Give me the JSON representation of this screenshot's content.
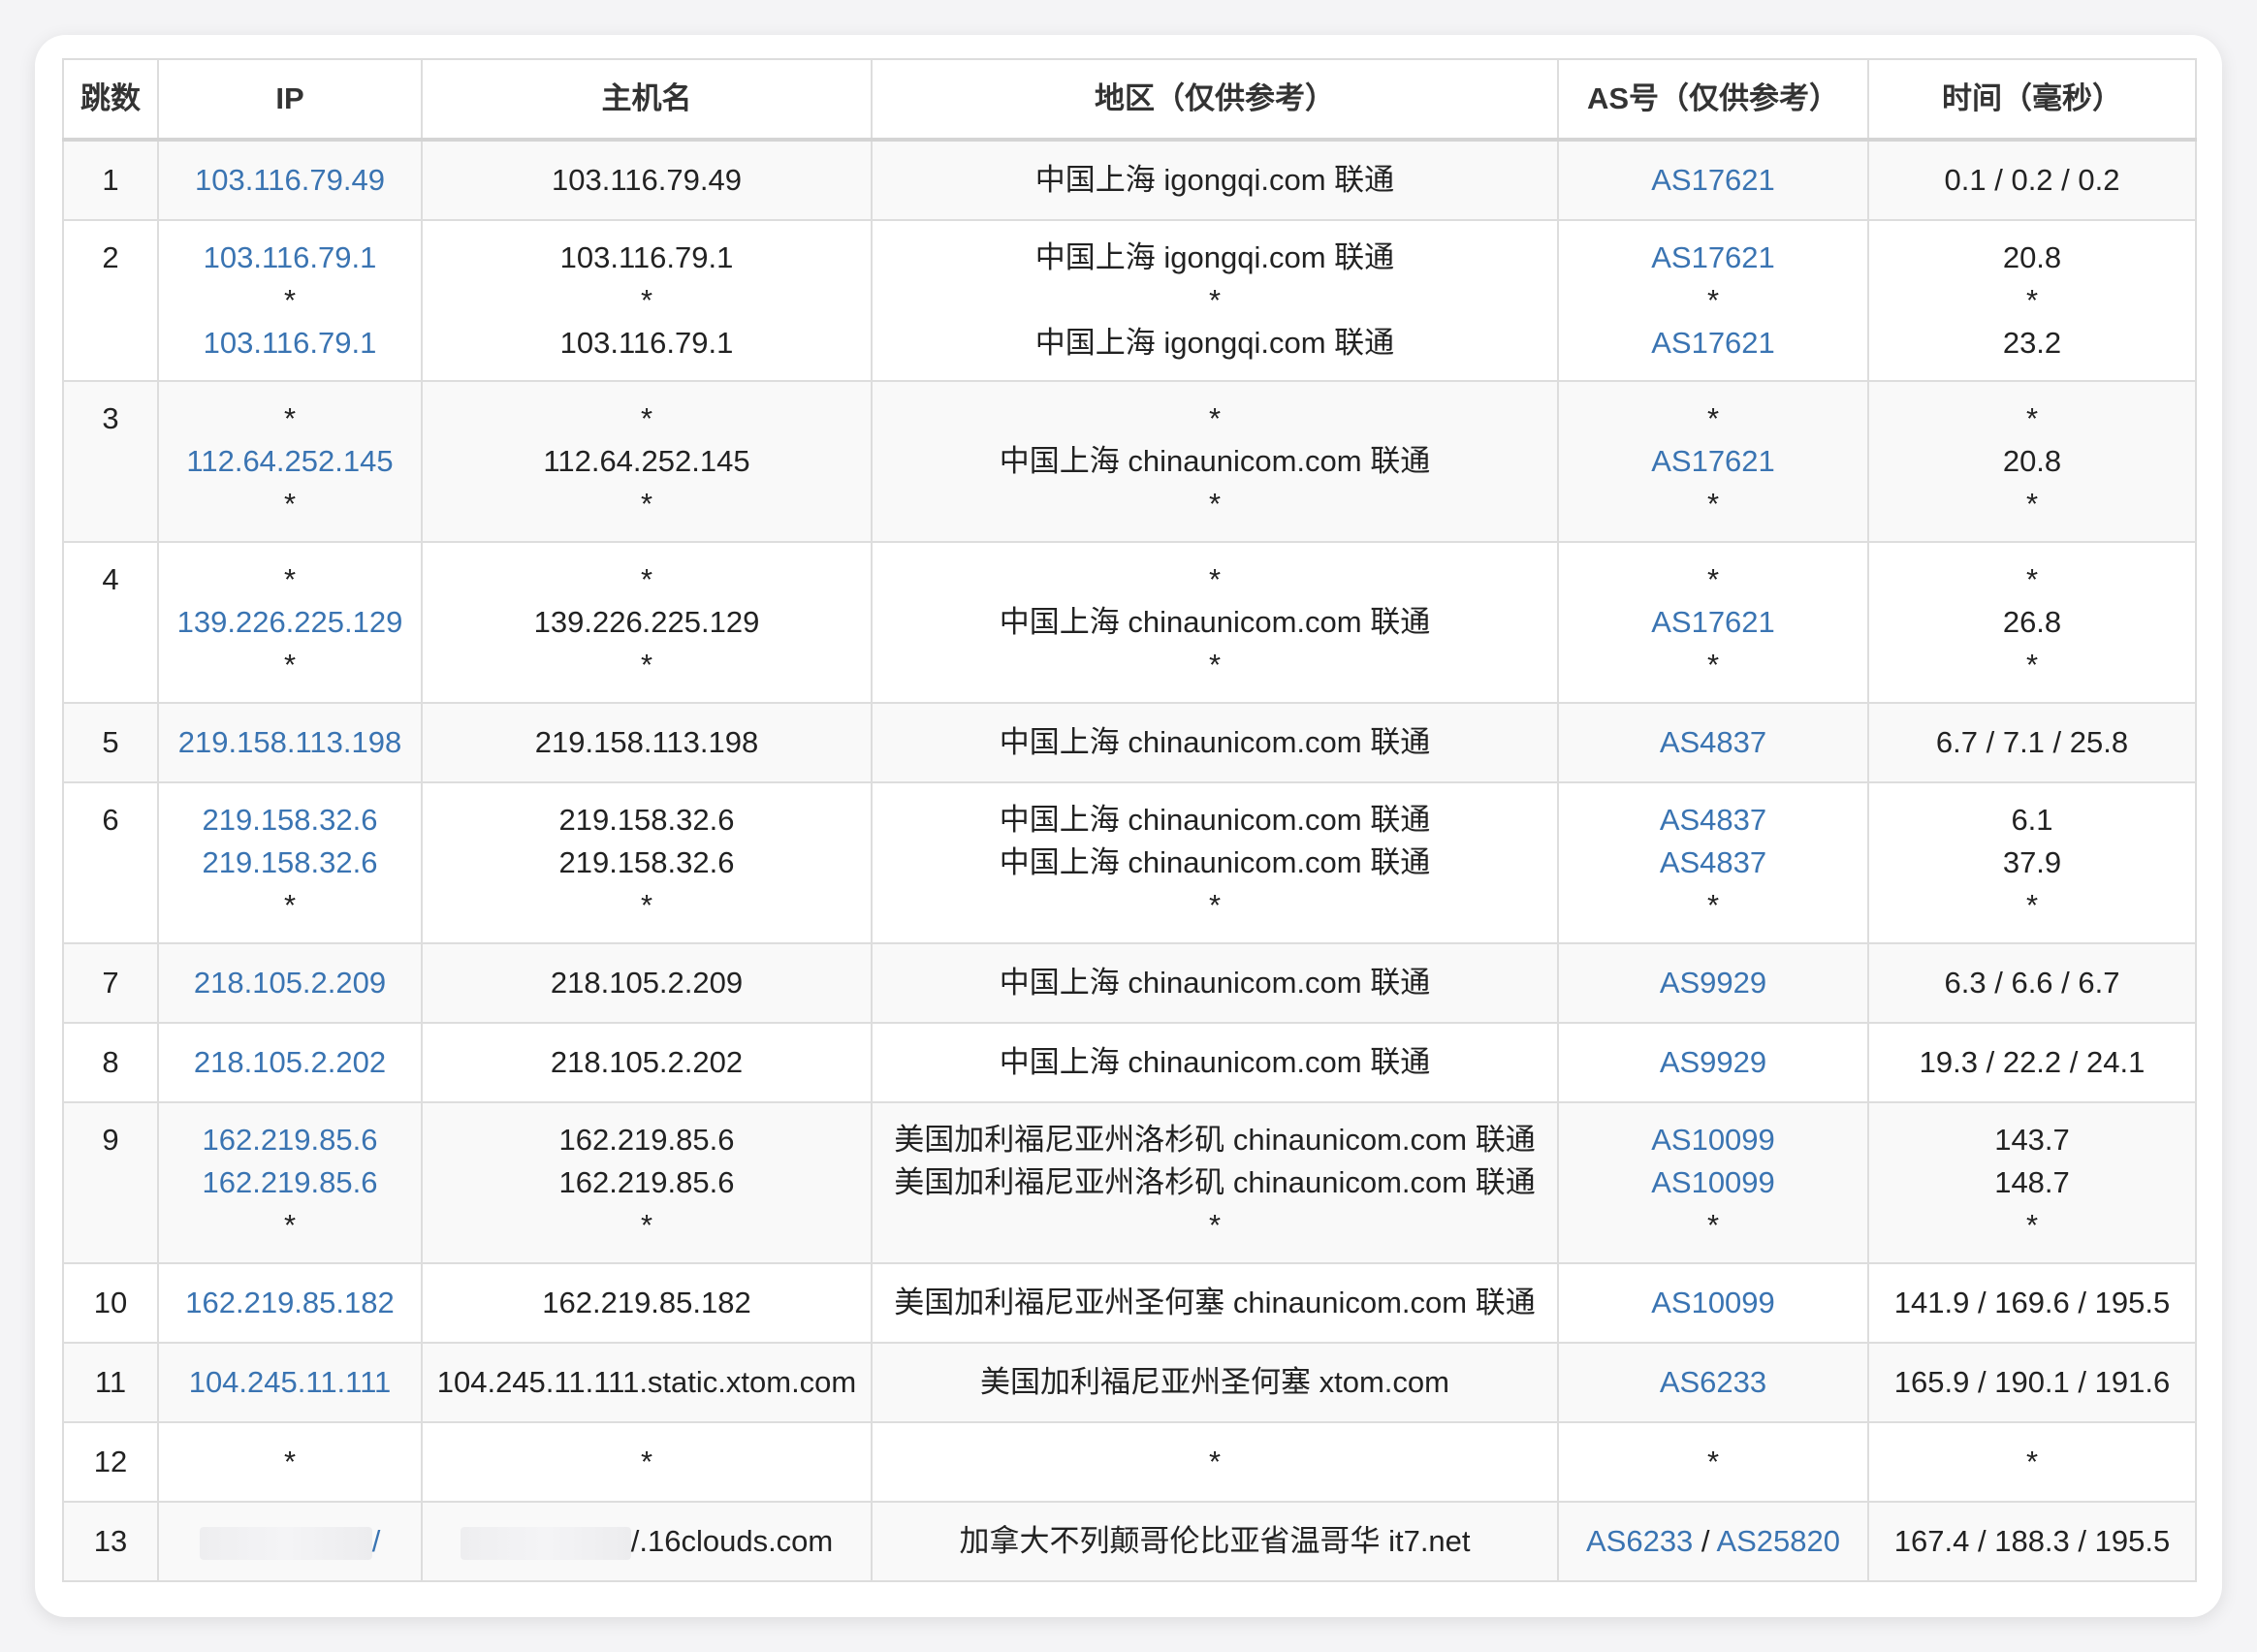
{
  "headers": [
    "跳数",
    "IP",
    "主机名",
    "地区（仅供参考）",
    "AS号（仅供参考）",
    "时间（毫秒）"
  ],
  "rows": [
    {
      "hop": "1",
      "ip": [
        "103.116.79.49"
      ],
      "host": [
        "103.116.79.49"
      ],
      "region": [
        "中国上海 igongqi.com 联通"
      ],
      "as": [
        "AS17621"
      ],
      "time": [
        "0.1 / 0.2 / 0.2"
      ]
    },
    {
      "hop": "2",
      "ip": [
        "103.116.79.1",
        "*",
        "103.116.79.1"
      ],
      "host": [
        "103.116.79.1",
        "*",
        "103.116.79.1"
      ],
      "region": [
        "中国上海 igongqi.com 联通",
        "*",
        "中国上海 igongqi.com 联通"
      ],
      "as": [
        "AS17621",
        "*",
        "AS17621"
      ],
      "time": [
        "20.8",
        "*",
        "23.2"
      ]
    },
    {
      "hop": "3",
      "ip": [
        "*",
        "112.64.252.145",
        "*"
      ],
      "host": [
        "*",
        "112.64.252.145",
        "*"
      ],
      "region": [
        "*",
        "中国上海 chinaunicom.com 联通",
        "*"
      ],
      "as": [
        "*",
        "AS17621",
        "*"
      ],
      "time": [
        "*",
        "20.8",
        "*"
      ]
    },
    {
      "hop": "4",
      "ip": [
        "*",
        "139.226.225.129",
        "*"
      ],
      "host": [
        "*",
        "139.226.225.129",
        "*"
      ],
      "region": [
        "*",
        "中国上海 chinaunicom.com 联通",
        "*"
      ],
      "as": [
        "*",
        "AS17621",
        "*"
      ],
      "time": [
        "*",
        "26.8",
        "*"
      ]
    },
    {
      "hop": "5",
      "ip": [
        "219.158.113.198"
      ],
      "host": [
        "219.158.113.198"
      ],
      "region": [
        "中国上海 chinaunicom.com 联通"
      ],
      "as": [
        "AS4837"
      ],
      "time": [
        "6.7 / 7.1 / 25.8"
      ]
    },
    {
      "hop": "6",
      "ip": [
        "219.158.32.6",
        "219.158.32.6",
        "*"
      ],
      "host": [
        "219.158.32.6",
        "219.158.32.6",
        "*"
      ],
      "region": [
        "中国上海 chinaunicom.com 联通",
        "中国上海 chinaunicom.com 联通",
        "*"
      ],
      "as": [
        "AS4837",
        "AS4837",
        "*"
      ],
      "time": [
        "6.1",
        "37.9",
        "*"
      ]
    },
    {
      "hop": "7",
      "ip": [
        "218.105.2.209"
      ],
      "host": [
        "218.105.2.209"
      ],
      "region": [
        "中国上海 chinaunicom.com 联通"
      ],
      "as": [
        "AS9929"
      ],
      "time": [
        "6.3 / 6.6 / 6.7"
      ]
    },
    {
      "hop": "8",
      "ip": [
        "218.105.2.202"
      ],
      "host": [
        "218.105.2.202"
      ],
      "region": [
        "中国上海 chinaunicom.com 联通"
      ],
      "as": [
        "AS9929"
      ],
      "time": [
        "19.3 / 22.2 / 24.1"
      ]
    },
    {
      "hop": "9",
      "ip": [
        "162.219.85.6",
        "162.219.85.6",
        "*"
      ],
      "host": [
        "162.219.85.6",
        "162.219.85.6",
        "*"
      ],
      "region": [
        "美国加利福尼亚州洛杉矶 chinaunicom.com 联通",
        "美国加利福尼亚州洛杉矶 chinaunicom.com 联通",
        "*"
      ],
      "as": [
        "AS10099",
        "AS10099",
        "*"
      ],
      "time": [
        "143.7",
        "148.7",
        "*"
      ]
    },
    {
      "hop": "10",
      "ip": [
        "162.219.85.182"
      ],
      "host": [
        "162.219.85.182"
      ],
      "region": [
        "美国加利福尼亚州圣何塞 chinaunicom.com 联通"
      ],
      "as": [
        "AS10099"
      ],
      "time": [
        "141.9 / 169.6 / 195.5"
      ]
    },
    {
      "hop": "11",
      "ip": [
        "104.245.11.111"
      ],
      "host": [
        "104.245.11.111.static.xtom.com"
      ],
      "region": [
        "美国加利福尼亚州圣何塞 xtom.com"
      ],
      "as": [
        "AS6233"
      ],
      "time": [
        "165.9 / 190.1 / 191.6"
      ]
    },
    {
      "hop": "12",
      "ip": [
        "*"
      ],
      "host": [
        "*"
      ],
      "region": [
        "*"
      ],
      "as": [
        "*"
      ],
      "time": [
        "*"
      ]
    },
    {
      "hop": "13",
      "ip": [
        "/"
      ],
      "host": [
        "/.16clouds.com"
      ],
      "region": [
        "加拿大不列颠哥伦比亚省温哥华 it7.net"
      ],
      "as": [
        "AS6233 / AS25820"
      ],
      "time": [
        "167.4 / 188.3 / 195.5"
      ]
    }
  ],
  "colors": {
    "link": "#3a74b2",
    "text": "#222222",
    "border": "#dddddd",
    "stripe": "#f9f9f9"
  }
}
